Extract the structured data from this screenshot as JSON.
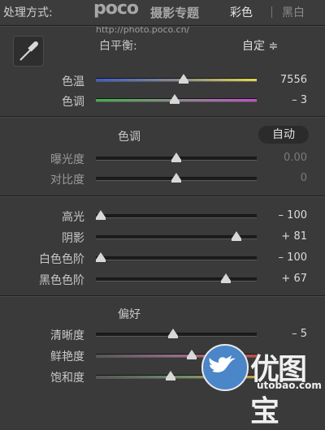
{
  "header": {
    "title": "处理方式:",
    "watermark_brand": "poco",
    "watermark_name": "摄影专题",
    "watermark_url": "http://photo.poco.cn/",
    "mode_color": "彩色",
    "mode_bw": "黑白"
  },
  "white_balance": {
    "label": "白平衡:",
    "preset": "自定 ≑",
    "rows": [
      {
        "label": "色温",
        "value": "7556",
        "level": 0.55
      },
      {
        "label": "色调",
        "value": "– 3",
        "level": 0.49
      }
    ]
  },
  "tone": {
    "title": "色调",
    "auto_label": "自动",
    "rows": [
      {
        "label": "曝光度",
        "value": "0.00",
        "level": 0.5
      },
      {
        "label": "对比度",
        "value": "0",
        "level": 0.5
      }
    ]
  },
  "tone2": {
    "rows": [
      {
        "label": "高光",
        "value": "– 100",
        "level": 0.0
      },
      {
        "label": "阴影",
        "value": "+ 81",
        "level": 0.9
      },
      {
        "label": "白色色阶",
        "value": "– 100",
        "level": 0.0
      },
      {
        "label": "黑色色阶",
        "value": "+ 67",
        "level": 0.83
      }
    ]
  },
  "presence": {
    "title": "偏好",
    "rows": [
      {
        "label": "清晰度",
        "value": "– 5",
        "level": 0.48
      },
      {
        "label": "鲜艳度",
        "value": "",
        "level": 0.6
      },
      {
        "label": "饱和度",
        "value": "",
        "level": 0.46
      }
    ]
  },
  "overlay_logo": {
    "name": "优图宝",
    "url": "utobao.com"
  },
  "colors": {
    "panel_bg": "#3a3a3a",
    "temp_gradient": [
      "#3b5bd6",
      "#e0d84a"
    ],
    "tint_gradient": [
      "#3fb04a",
      "#c54cd0"
    ],
    "logo_blue": "#4a86c8"
  },
  "icons": [
    "eyedropper-icon",
    "bird-icon"
  ]
}
